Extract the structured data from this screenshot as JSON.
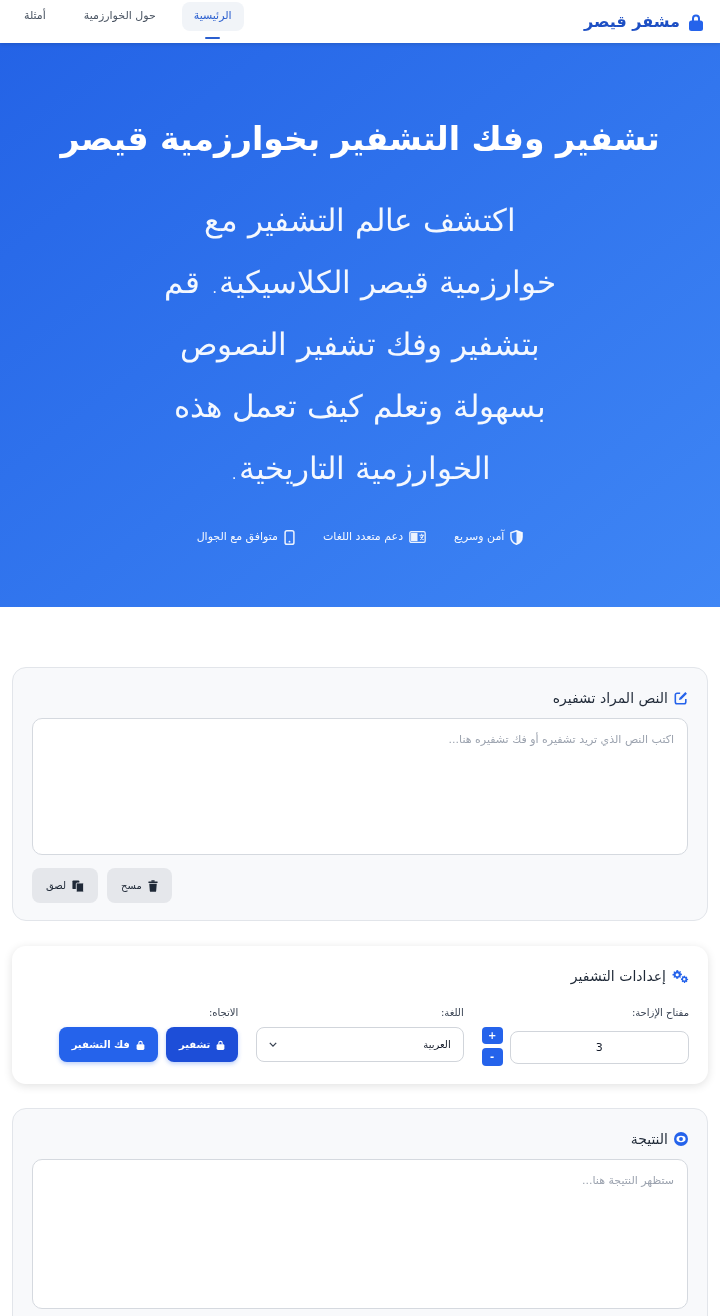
{
  "navbar": {
    "brand": "مشفر قيصر",
    "links": [
      {
        "label": "الرئيسية",
        "selected": true
      },
      {
        "label": "حول الخوارزمية",
        "selected": false
      },
      {
        "label": "أمثلة",
        "selected": false
      }
    ]
  },
  "hero": {
    "title": "تشفير وفك التشفير بخوارزمية قيصر",
    "subtitle": "اكتشف عالم التشفير مع خوارزمية قيصر الكلاسيكية. قم بتشفير وفك تشفير النصوص بسهولة وتعلم كيف تعمل هذه الخوارزمية التاريخية.",
    "features": [
      "آمن وسريع",
      "دعم متعدد اللغات",
      "متوافق مع الجوال"
    ]
  },
  "input_card": {
    "title": "النص المراد تشفيره",
    "placeholder": "اكتب النص الذي تريد تشفيره أو فك تشفيره هنا...",
    "buttons": [
      "مسح",
      "لصق"
    ]
  },
  "settings_card": {
    "title": "إعدادات التشفير",
    "shift_key": {
      "label": "مفتاح الإزاحة:",
      "value": "3",
      "increment": "+",
      "decrement": "-"
    },
    "language": {
      "label": "اللغة:",
      "value": "العربية"
    },
    "direction": {
      "label": "الاتجاه:",
      "buttons": [
        {
          "label": "تشفير",
          "selected": true
        },
        {
          "label": "فك التشفير",
          "selected": false
        }
      ]
    }
  },
  "result_card": {
    "title": "النتيجة",
    "placeholder": "ستظهر النتيجة هنا..."
  }
}
